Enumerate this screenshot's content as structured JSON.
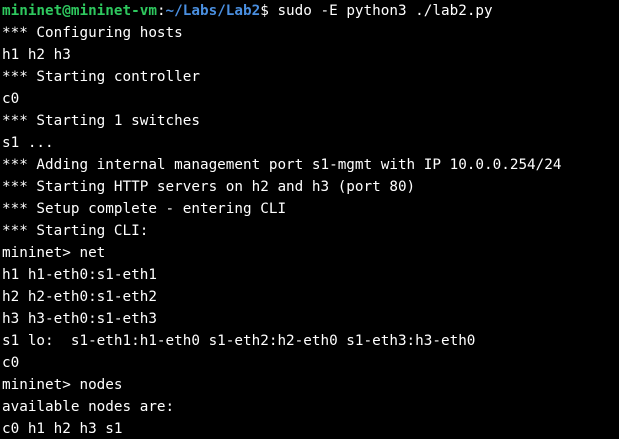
{
  "prompt": {
    "user_host": "mininet@mininet-vm",
    "separator": ":",
    "path": "~/Labs/Lab2",
    "symbol": "$ ",
    "command": "sudo -E python3 ./lab2.py"
  },
  "colors": {
    "background": "#000000",
    "text": "#ffffff",
    "user_host": "#2ec85e",
    "path": "#4a8fe0"
  },
  "output": [
    "*** Configuring hosts",
    "h1 h2 h3",
    "*** Starting controller",
    "c0",
    "*** Starting 1 switches",
    "s1 ...",
    "*** Adding internal management port s1-mgmt with IP 10.0.0.254/24",
    "*** Starting HTTP servers on h2 and h3 (port 80)",
    "*** Setup complete - entering CLI",
    "*** Starting CLI:",
    "mininet> net",
    "h1 h1-eth0:s1-eth1",
    "h2 h2-eth0:s1-eth2",
    "h3 h3-eth0:s1-eth3",
    "s1 lo:  s1-eth1:h1-eth0 s1-eth2:h2-eth0 s1-eth3:h3-eth0",
    "c0",
    "mininet> nodes",
    "available nodes are:",
    "c0 h1 h2 h3 s1"
  ]
}
